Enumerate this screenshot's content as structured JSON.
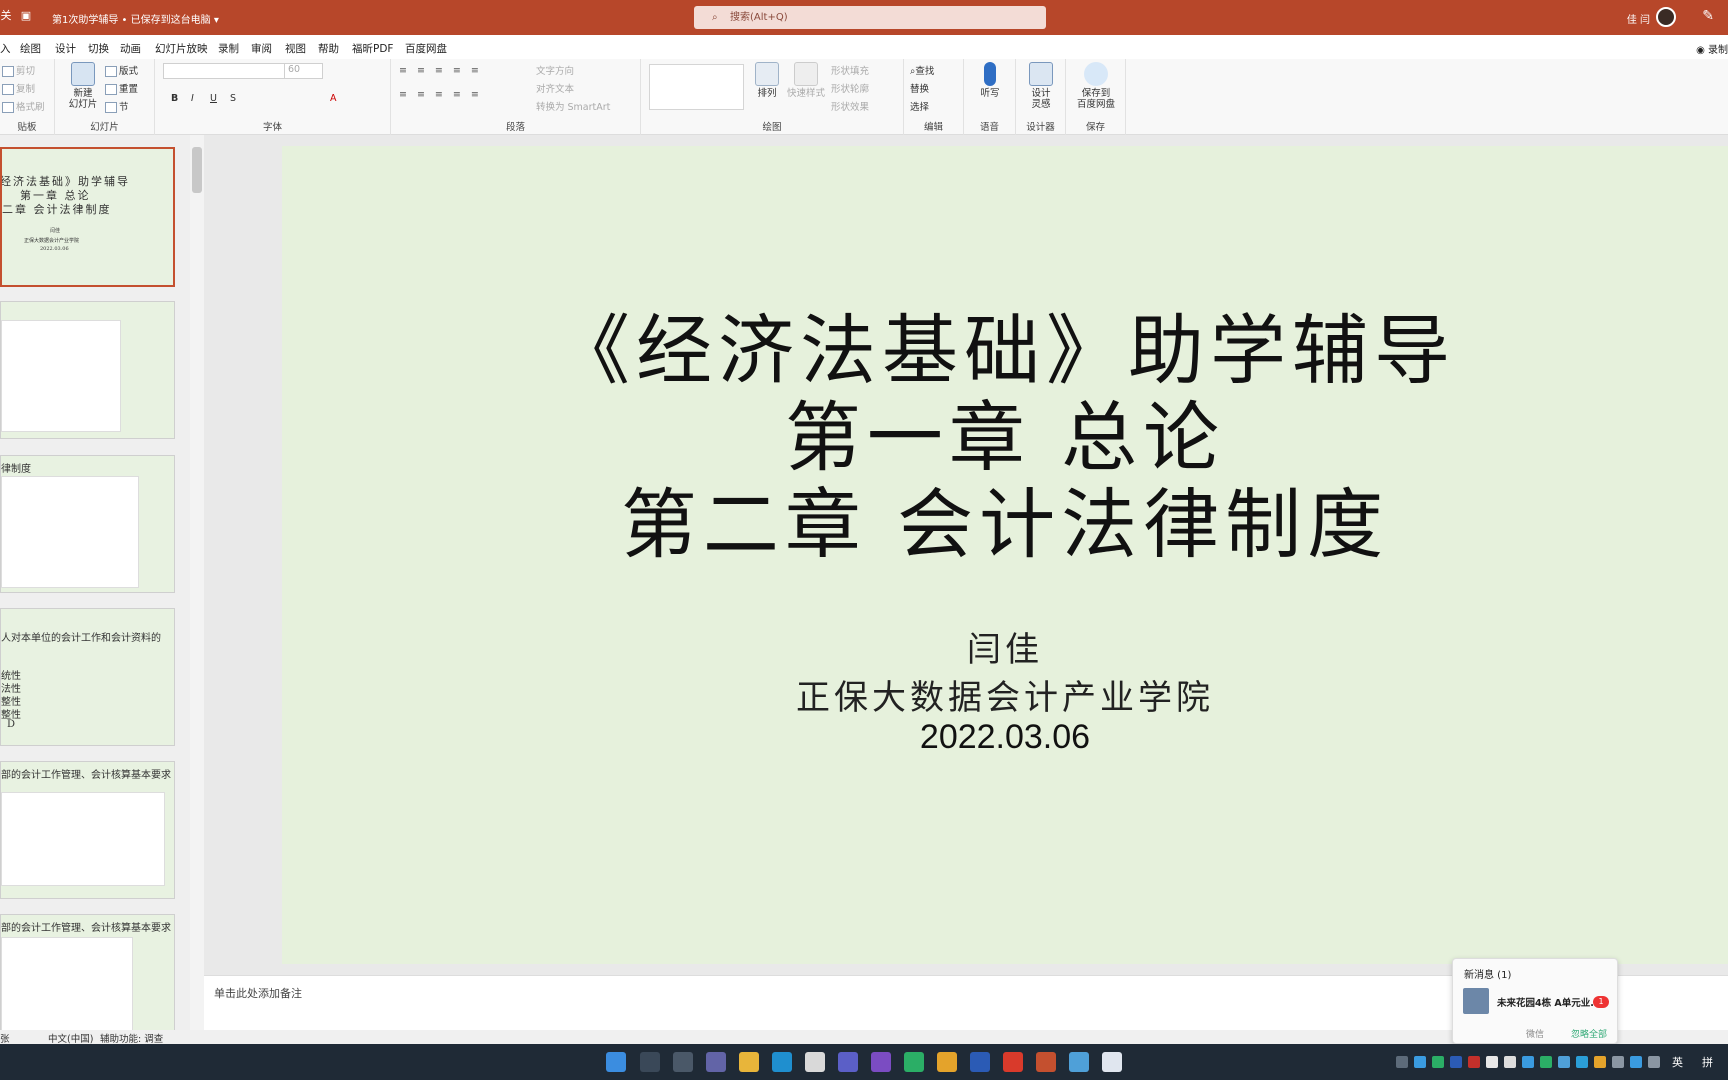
{
  "titlebar": {
    "title": "第1次助学辅导 • 已保存到这台电脑",
    "title_caret": "▾",
    "close_glyph": "关",
    "save_glyph": "▣",
    "search_placeholder": "搜索(Alt+Q)",
    "user": "佳 闫",
    "pen_glyph": "✎",
    "bg_color": "#b7472a"
  },
  "tabs": [
    "入",
    "绘图",
    "设计",
    "切换",
    "动画",
    "幻灯片放映",
    "录制",
    "审阅",
    "视图",
    "帮助",
    "福昕PDF",
    "百度网盘"
  ],
  "record_label": "◉ 录制",
  "ribbon": {
    "clipboard": {
      "cut": "剪切",
      "copy": "复制",
      "format": "格式刷",
      "label": "贴板"
    },
    "slides": {
      "new": "新建\n幻灯片",
      "layout": "版式",
      "reset": "重置",
      "section": "节",
      "label": "幻灯片"
    },
    "font": {
      "size": "60",
      "label": "字体"
    },
    "paragraph": {
      "text_dir": "文字方向",
      "align": "对齐文本",
      "smartart": "转换为 SmartArt",
      "label": "段落"
    },
    "drawing": {
      "arrange": "排列",
      "quick_style": "快速样式",
      "fill": "形状填充",
      "outline": "形状轮廓",
      "effect": "形状效果",
      "label": "绘图"
    },
    "editing": {
      "find": "查找",
      "replace": "替换",
      "select": "选择",
      "label": "编辑"
    },
    "voice": {
      "dictate": "听写",
      "label": "语音"
    },
    "designer": {
      "ideas": "设计\n灵感",
      "label": "设计器"
    },
    "save": {
      "baidu": "保存到\n百度网盘",
      "label": "保存"
    }
  },
  "thumbnails": [
    {
      "lines": [
        "经济法基础》助学辅导",
        "第一章 总论",
        "二章 会计法律制度",
        "闫佳",
        "正保大数据会计产业学院",
        "2022.03.06"
      ]
    },
    {
      "lines": []
    },
    {
      "lines": [
        "律制度"
      ]
    },
    {
      "lines": [
        "人对本单位的会计工作和会计资料的",
        "统性",
        "法性",
        "整性",
        "整性",
        "D"
      ]
    },
    {
      "lines": [
        "部的会计工作管理、会计核算基本要求"
      ]
    },
    {
      "lines": [
        "部的会计工作管理、会计核算基本要求"
      ]
    }
  ],
  "slide": {
    "title1": "《经济法基础》助学辅导",
    "title2": "第一章 总论",
    "title3": "第二章 会计法律制度",
    "author": "闫佳",
    "school": "正保大数据会计产业学院",
    "date": "2022.03.06",
    "bg_color": "#e6f1dc"
  },
  "notes_placeholder": "单击此处添加备注",
  "status": {
    "lang": "中文(中国)",
    "accessibility": "辅助功能: 调查",
    "slide_count": "张"
  },
  "notification": {
    "header": "新消息 (1)",
    "message": "未来花园4栋 A单元业...",
    "badge": "1",
    "wechat": "微信",
    "ignore_all": "忽略全部"
  },
  "taskbar": {
    "ime1": "英",
    "ime2": "拼"
  }
}
